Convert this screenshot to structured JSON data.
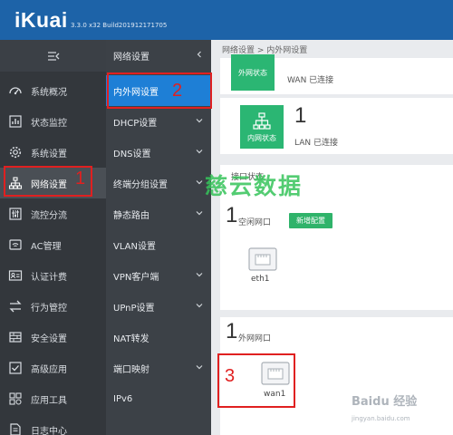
{
  "header": {
    "logo": "iKuai",
    "version": "3.3.0 x32 Build201912171705"
  },
  "sidebar_primary": {
    "items": [
      {
        "label": "系统概况",
        "icon": "gauge-icon"
      },
      {
        "label": "状态监控",
        "icon": "monitor-chart-icon"
      },
      {
        "label": "系统设置",
        "icon": "gear-icon"
      },
      {
        "label": "网络设置",
        "icon": "network-tree-icon",
        "active": true
      },
      {
        "label": "流控分流",
        "icon": "sliders-icon"
      },
      {
        "label": "AC管理",
        "icon": "wifi-icon"
      },
      {
        "label": "认证计费",
        "icon": "id-card-icon"
      },
      {
        "label": "行为管控",
        "icon": "swap-arrows-icon"
      },
      {
        "label": "安全设置",
        "icon": "firewall-icon"
      },
      {
        "label": "高级应用",
        "icon": "checkbox-icon"
      },
      {
        "label": "应用工具",
        "icon": "apps-grid-icon"
      },
      {
        "label": "日志中心",
        "icon": "document-icon"
      }
    ]
  },
  "sidebar_secondary": {
    "header": "网络设置",
    "items": [
      {
        "label": "内外网设置",
        "active": true,
        "has_chevron": false
      },
      {
        "label": "DHCP设置",
        "has_chevron": true
      },
      {
        "label": "DNS设置",
        "has_chevron": true
      },
      {
        "label": "终端分组设置",
        "has_chevron": true
      },
      {
        "label": "静态路由",
        "has_chevron": true
      },
      {
        "label": "VLAN设置",
        "has_chevron": false
      },
      {
        "label": "VPN客户端",
        "has_chevron": true
      },
      {
        "label": "UPnP设置",
        "has_chevron": true
      },
      {
        "label": "NAT转发",
        "has_chevron": false
      },
      {
        "label": "端口映射",
        "has_chevron": true
      },
      {
        "label": "IPv6",
        "has_chevron": false
      }
    ]
  },
  "main": {
    "breadcrumb": "网络设置 > 内外网设置",
    "wan_status": {
      "tile_label": "外网状态",
      "status": "WAN 已连接"
    },
    "lan_status": {
      "tile_label": "内网状态",
      "count": "1",
      "status": "LAN 已连接"
    },
    "interface_section": "接口状态",
    "idle_ports": {
      "count": "1",
      "label": "空闲网口",
      "button": "新增配置",
      "port_name": "eth1"
    },
    "wan_ports": {
      "count": "1",
      "label": "外网网口",
      "port_name": "wan1"
    }
  },
  "annotations": {
    "step1": "1",
    "step2": "2",
    "step3": "3"
  },
  "watermark": {
    "text": "慈云数据",
    "baidu": "Baidu 经验",
    "url": "jingyan.baidu.com"
  },
  "colors": {
    "header": "#1d63a8",
    "active_item": "#1e7fd6",
    "tile_green": "#2bb673",
    "annotation": "#e02020"
  }
}
